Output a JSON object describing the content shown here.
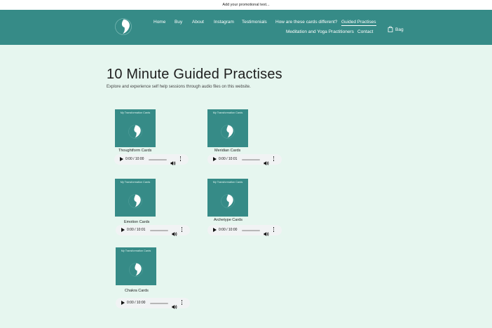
{
  "promo": {
    "text": "Add your promotional text..."
  },
  "nav": {
    "items": [
      {
        "label": "Home"
      },
      {
        "label": "Buy"
      },
      {
        "label": "About"
      },
      {
        "label": "Instagram"
      },
      {
        "label": "Testimonials"
      },
      {
        "label": "How are these cards different?"
      },
      {
        "label": "Guided Practises",
        "active": true
      },
      {
        "label": "Meditation and Yoga Practitioners"
      },
      {
        "label": "Contact"
      }
    ],
    "bag_label": "Bag"
  },
  "colors": {
    "header": "#368b87",
    "background": "#e6f6ef",
    "card": "#368b87",
    "player": "#f1f3f4"
  },
  "page": {
    "title": "10 Minute Guided Practises",
    "subtitle": "Explore and experience self help sessions through audio files on this website."
  },
  "cards": [
    {
      "image_text": "My Transformation Cards",
      "label": "Thoughtform Cards",
      "time": "0:00 / 10:00"
    },
    {
      "image_text": "My Transformation Cards",
      "label": "Meridian Cards",
      "time": "0:00 / 10:01"
    },
    {
      "image_text": "My Transformation Cards",
      "label": "Emotion Cards",
      "time": "0:00 / 10:01"
    },
    {
      "image_text": "My Transformation Cards",
      "label": "Archetype Cards",
      "time": "0:00 / 10:00"
    },
    {
      "image_text": "My Transformation Cards",
      "label": "Chakra Cards",
      "time": "0:00 / 10:00"
    }
  ],
  "icons": {
    "logo": "logo-icon",
    "bag": "bag-icon",
    "play": "play-icon",
    "volume": "volume-icon",
    "more": "more-options-icon"
  }
}
